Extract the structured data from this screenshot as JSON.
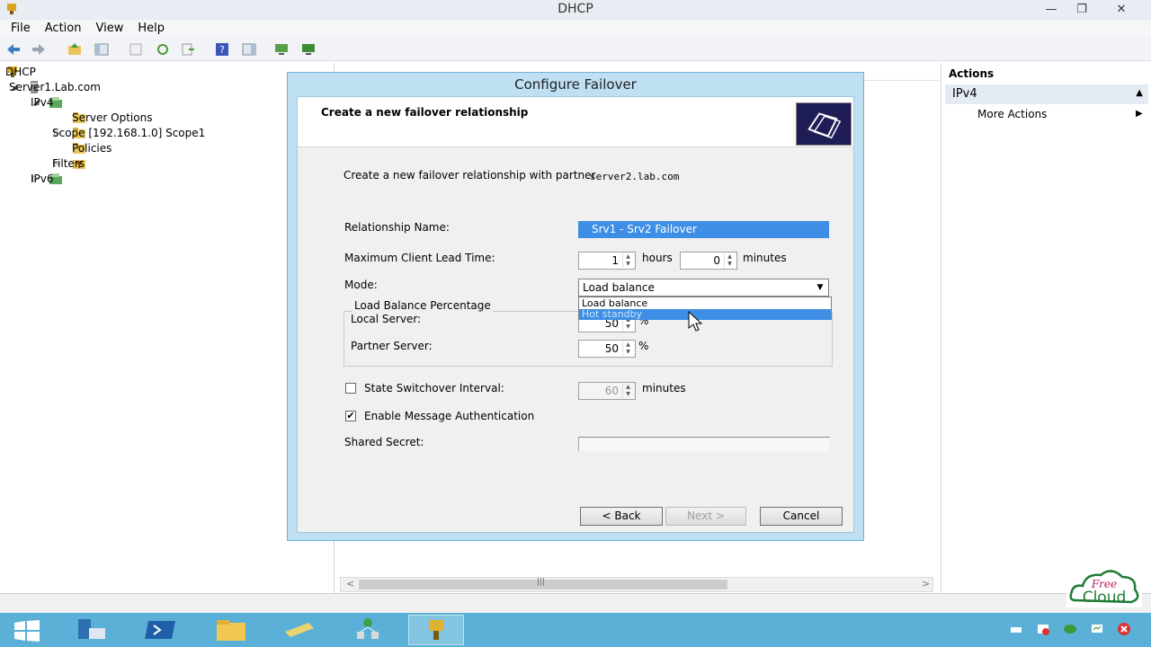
{
  "window": {
    "title": "DHCP",
    "buttons": {
      "minimize": "—",
      "restore": "❐",
      "close": "✕"
    }
  },
  "menu": [
    "File",
    "Action",
    "View",
    "Help"
  ],
  "tree": {
    "items": [
      {
        "label": "DHCP",
        "icon": "dhcp-icon",
        "expander": ""
      },
      {
        "label": "Server1.Lab.com",
        "icon": "server-icon",
        "expander": "◢"
      },
      {
        "label": "IPv4",
        "icon": "ipv4-icon",
        "expander": "◢"
      },
      {
        "label": "Server Options",
        "icon": "folder-icon",
        "expander": ""
      },
      {
        "label": "Scope [192.168.1.0] Scope1",
        "icon": "folder-icon",
        "expander": "▷"
      },
      {
        "label": "Policies",
        "icon": "folder-icon",
        "expander": ""
      },
      {
        "label": "Filters",
        "icon": "filter-icon",
        "expander": "▷"
      },
      {
        "label": "IPv6",
        "icon": "ipv6-icon",
        "expander": "▷"
      }
    ]
  },
  "actions": {
    "title": "Actions",
    "section": "IPv4",
    "collapse": "▲",
    "item": "More Actions",
    "item_arrow": "▶"
  },
  "dialog": {
    "title": "Configure Failover",
    "header": "Create a new failover relationship",
    "partner_prompt": "Create a new failover relationship with partner",
    "partner_name": "server2.lab.com",
    "relationship_label": "Relationship Name:",
    "relationship_value": "Srv1 - Srv2 Failover",
    "mclt_label": "Maximum Client Lead Time:",
    "mclt_hours": "1",
    "hours_label": "hours",
    "mclt_minutes": "0",
    "minutes_label": "minutes",
    "mode_label": "Mode:",
    "mode_value": "Load balance",
    "mode_options": [
      "Load balance",
      "Hot standby"
    ],
    "mode_highlighted": "Hot standby",
    "lb_group": "Load Balance Percentage",
    "local_server_label": "Local Server:",
    "local_server_value": "50",
    "partner_server_label": "Partner Server:",
    "partner_server_value": "50",
    "percent": "%",
    "switchover_label": "State Switchover Interval:",
    "switchover_checked": false,
    "switchover_value": "60",
    "switchover_unit": "minutes",
    "auth_label": "Enable Message Authentication",
    "auth_checked": true,
    "auth_check_glyph": "✔",
    "secret_label": "Shared Secret:",
    "secret_value": "",
    "buttons": {
      "back": "< Back",
      "next": "Next >",
      "cancel": "Cancel"
    }
  },
  "scrollbar": {
    "left": "<",
    "grip": "|||",
    "right": ">"
  },
  "watermark": {
    "line1": "Free",
    "line2": "Cloud"
  },
  "colors": {
    "accent": "#3d8ee4",
    "taskbar": "#5ab0d6",
    "dialog_frame": "#bfe0f3"
  }
}
